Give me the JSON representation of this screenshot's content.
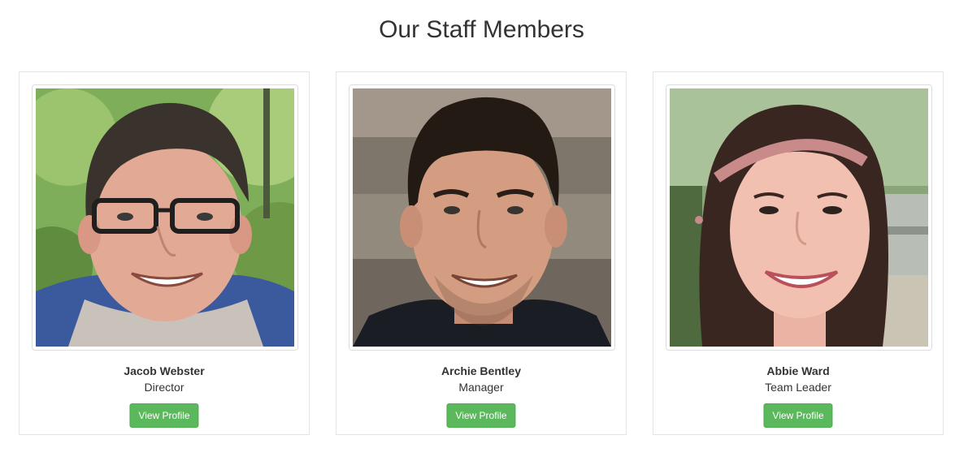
{
  "page": {
    "title": "Our Staff Members"
  },
  "staff": [
    {
      "name": "Jacob Webster",
      "role": "Director",
      "button_label": "View Profile",
      "photo_alt": "Jacob Webster"
    },
    {
      "name": "Archie Bentley",
      "role": "Manager",
      "button_label": "View Profile",
      "photo_alt": "Archie Bentley"
    },
    {
      "name": "Abbie Ward",
      "role": "Team Leader",
      "button_label": "View Profile",
      "photo_alt": "Abbie Ward"
    }
  ],
  "colors": {
    "button": "#5cb85c",
    "button_border": "#4cae4c",
    "card_border": "#e3e3e3",
    "text": "#333333"
  }
}
